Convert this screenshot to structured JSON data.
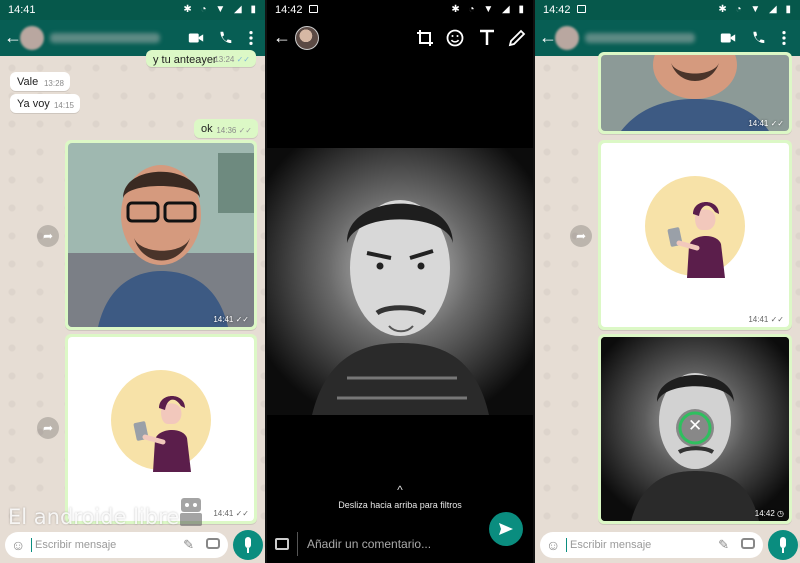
{
  "panel_left": {
    "status_time": "14:41",
    "messages": [
      {
        "text": "y tu anteayer",
        "time": "13:24",
        "dir": "out"
      },
      {
        "text": "Vale",
        "time": "13:28",
        "dir": "in"
      },
      {
        "text": "Ya voy",
        "time": "14:15",
        "dir": "in"
      },
      {
        "text": "ok",
        "time": "14:36",
        "dir": "out"
      }
    ],
    "photo_time": "14:41",
    "illustration_time": "14:41",
    "input_placeholder": "Escribir mensaje",
    "watermark": "El androide libre"
  },
  "panel_middle": {
    "status_time": "14:42",
    "hint_arrow": "^",
    "hint_text": "Desliza hacia arriba para filtros",
    "comment_placeholder": "Añadir un comentario..."
  },
  "panel_right": {
    "status_time": "14:42",
    "img1_time": "14:41",
    "img2_time": "14:41",
    "img3_time": "14:42",
    "input_placeholder": "Escribir mensaje"
  },
  "colors": {
    "header": "#075e54",
    "accent": "#0a8d7f",
    "outgoing_bubble": "#dcf8c6",
    "incoming_bubble": "#ffffff",
    "chat_bg": "#e6ddd4"
  }
}
